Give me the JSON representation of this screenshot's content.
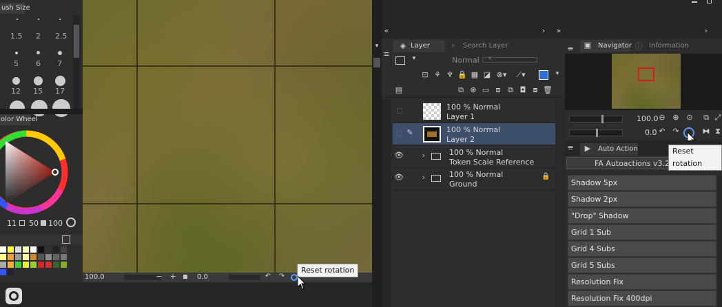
{
  "left_panel": {
    "brush_size_title": "ush Size",
    "brush_sizes_row1": [
      "1.5",
      "2",
      "2.5"
    ],
    "brush_sizes_row2": [
      "5",
      "6",
      "7"
    ],
    "brush_sizes_row3": [
      "12",
      "15",
      "17"
    ],
    "color_wheel_title": "olor Wheel",
    "hsv_values": {
      "h": "11",
      "s": "50",
      "v": "100"
    }
  },
  "canvas_bar": {
    "zoom_value": "100.0",
    "rotation_value": "0.0",
    "tooltip": "Reset rotation"
  },
  "layer_panel": {
    "tab_layer": "Layer",
    "tab_search": "Search Layer",
    "blend_mode": "Normal",
    "layers": [
      {
        "mode": "100 % Normal",
        "name": "Layer 1"
      },
      {
        "mode": "100 % Normal",
        "name": "Layer 2"
      },
      {
        "mode": "100 % Normal",
        "name": "Token Scale Reference"
      },
      {
        "mode": "100 % Normal",
        "name": "Ground"
      }
    ]
  },
  "navigator": {
    "tab_navigator": "Navigator",
    "tab_information": "Information",
    "zoom_value": "100.0",
    "rotation_value": "0.0",
    "tooltip": "Reset rotation"
  },
  "auto_action": {
    "title": "Auto Action",
    "set_name": "FA Autoactions v3.2",
    "actions": [
      "Shadow 5px",
      "Shadow 2px",
      "\"Drop\" Shadow",
      "Grid 1 Sub",
      "Grid 4 Subs",
      "Grid 5 Subs",
      "Resolution Fix",
      "Resolution Fix 400dpi"
    ]
  },
  "colors": {
    "panel": "#2d2d2d",
    "selected_layer": "#3d4f6a",
    "action_button": "#4a4a4a"
  }
}
